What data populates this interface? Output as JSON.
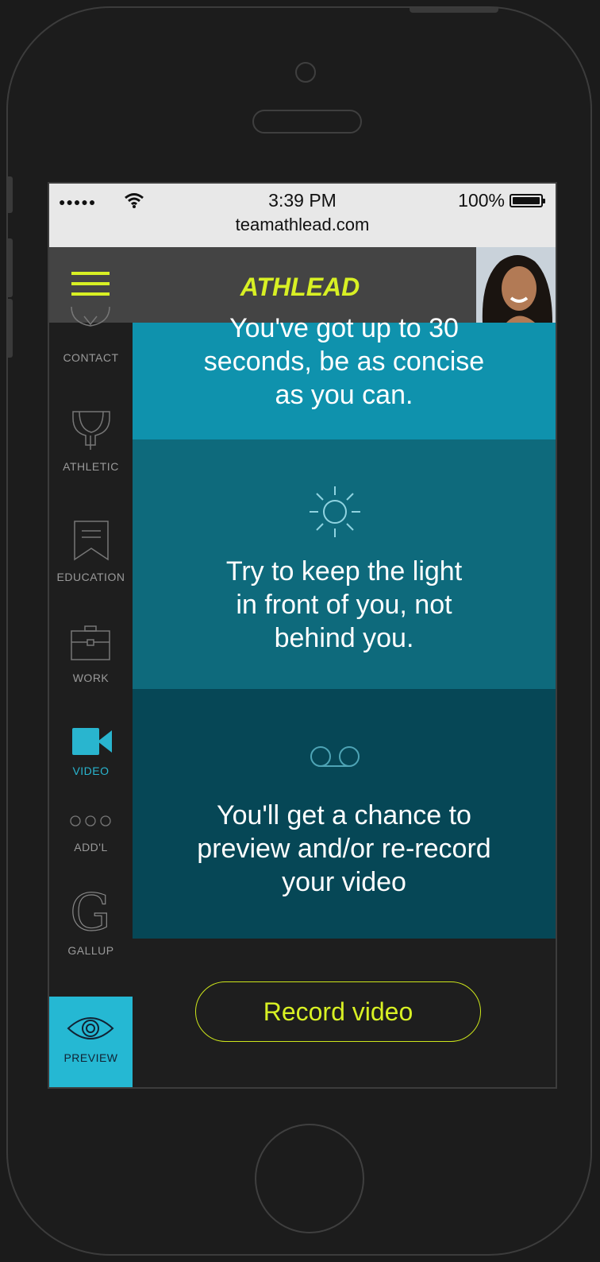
{
  "status_bar": {
    "signal": "●●●●●",
    "time": "3:39 PM",
    "battery": "100%",
    "url": "teamathlead.com"
  },
  "header": {
    "logo": "ATHLEAD",
    "menu_icon": "hamburger-icon",
    "accent": "#d8f024"
  },
  "sidebar": {
    "items": [
      {
        "label": "CONTACT",
        "icon": "contact-icon"
      },
      {
        "label": "ATHLETIC",
        "icon": "trophy-icon"
      },
      {
        "label": "EDUCATION",
        "icon": "bookmark-icon"
      },
      {
        "label": "WORK",
        "icon": "briefcase-icon"
      },
      {
        "label": "VIDEO",
        "icon": "video-camera-icon",
        "active": true
      },
      {
        "label": "ADD'L",
        "icon": "dots-icon"
      },
      {
        "label": "GALLUP",
        "icon": "gallup-g-icon"
      },
      {
        "label": "PREVIEW",
        "icon": "eye-icon"
      }
    ],
    "active_color": "#29b5cf"
  },
  "tips": [
    {
      "lines": [
        "You've got up to 30",
        "seconds, be as concise",
        "as you can."
      ],
      "color": "#0f92ad"
    },
    {
      "lines": [
        "Try to keep the light",
        "in front of you, not",
        "behind you."
      ],
      "icon": "sun-icon",
      "color": "#0e6a7c"
    },
    {
      "lines": [
        "You'll get a chance to",
        "preview and/or re-record",
        "your video"
      ],
      "icon": "voicemail-icon",
      "color": "#064756"
    }
  ],
  "record_button": {
    "label": "Record video"
  }
}
